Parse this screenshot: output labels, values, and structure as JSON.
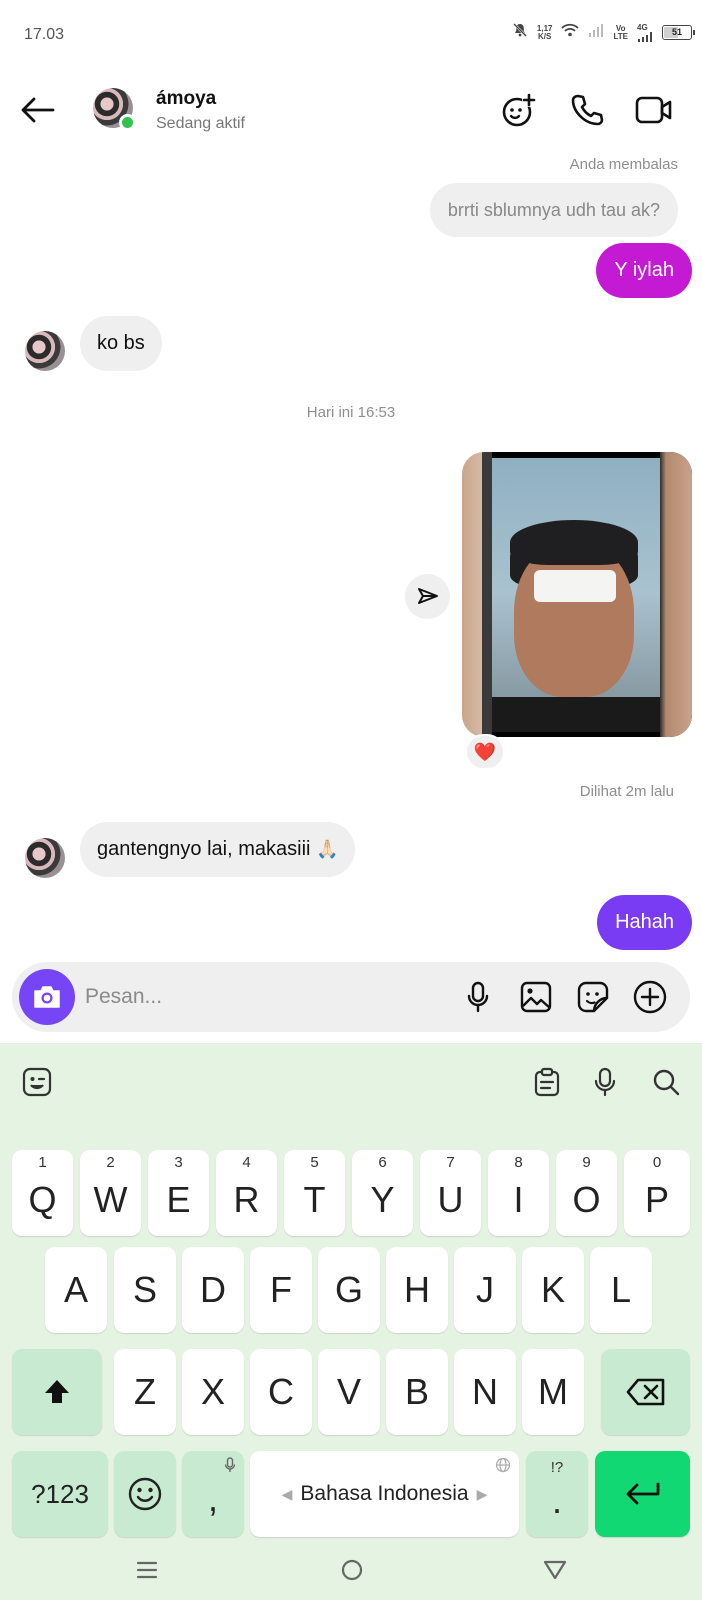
{
  "status_bar": {
    "time": "17.03",
    "net_speed_value": "1,17",
    "net_speed_unit": "K/S",
    "volte_top": "Vo",
    "volte_bottom": "LTE",
    "network": "4G",
    "battery": "51"
  },
  "header": {
    "contact_name": "ámoya",
    "contact_status": "Sedang aktif"
  },
  "messages": {
    "reply_label": "Anda membalas",
    "reply_quote": "brrti sblumnya udh tau ak?",
    "out_1": "Y iylah",
    "in_1": "ko bs",
    "timestamp": "Hari ini 16:53",
    "photo_reaction": "❤️",
    "seen_label": "Dilihat 2m lalu",
    "in_2": "gantengnyo lai, makasiii",
    "in_2_emoji": "🙏🏻",
    "out_2": "Hahah"
  },
  "composer": {
    "placeholder": "Pesan..."
  },
  "keyboard": {
    "row1": [
      {
        "hint": "1",
        "key": "Q"
      },
      {
        "hint": "2",
        "key": "W"
      },
      {
        "hint": "3",
        "key": "E"
      },
      {
        "hint": "4",
        "key": "R"
      },
      {
        "hint": "5",
        "key": "T"
      },
      {
        "hint": "6",
        "key": "Y"
      },
      {
        "hint": "7",
        "key": "U"
      },
      {
        "hint": "8",
        "key": "I"
      },
      {
        "hint": "9",
        "key": "O"
      },
      {
        "hint": "0",
        "key": "P"
      }
    ],
    "row2": [
      "A",
      "S",
      "D",
      "F",
      "G",
      "H",
      "J",
      "K",
      "L"
    ],
    "row3": [
      "Z",
      "X",
      "C",
      "V",
      "B",
      "N",
      "M"
    ],
    "symbols_key": "?123",
    "comma_key": ",",
    "space_label": "Bahasa Indonesia",
    "punct_hint": "!?",
    "period_key": "."
  },
  "colors": {
    "accent_purple": "#7645f6",
    "bubble_magenta": "#c41ad4",
    "bubble_violet": "#7a3cf3",
    "incoming_bubble": "#efefef",
    "keyboard_bg": "#e5f3e3",
    "enter_key": "#12d874",
    "online": "#33c24d"
  },
  "icons": {
    "back": "arrow-left-icon",
    "add_people": "add-people-icon",
    "call": "phone-icon",
    "video": "video-camera-icon",
    "share": "paper-plane-icon",
    "camera": "camera-icon",
    "mic": "microphone-icon",
    "gallery": "image-icon",
    "sticker": "sticker-icon",
    "more": "plus-circle-icon"
  }
}
